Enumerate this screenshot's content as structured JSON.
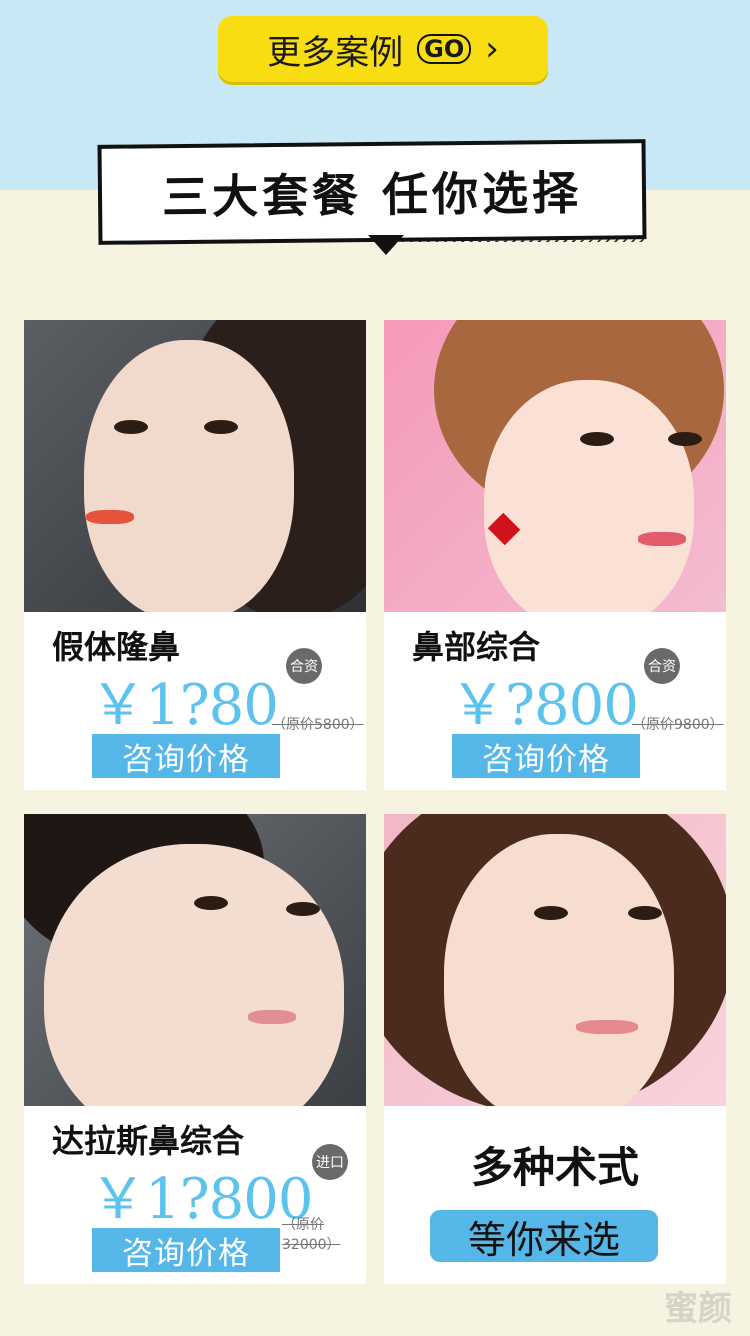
{
  "more_cases": {
    "label": "更多案例",
    "go_icon": "GO",
    "arrow_icon": "chevron-right-icon"
  },
  "banner": {
    "title": "三大套餐  任你选择"
  },
  "cards": [
    {
      "title": "假体隆鼻",
      "tag": "合资",
      "price": "￥1?80",
      "original_price": "（原价5800）",
      "button": "咨询价格"
    },
    {
      "title": "鼻部综合",
      "tag": "合资",
      "price": "￥?800",
      "original_price": "（原价9800）",
      "button": "咨询价格"
    },
    {
      "title": "达拉斯鼻综合",
      "tag": "进口",
      "price": "￥1?800",
      "original_price": "（原价32000）",
      "button": "咨询价格"
    },
    {
      "title": "多种术式",
      "button": "等你来选"
    }
  ],
  "watermark": "蜜颜",
  "colors": {
    "accent_blue": "#55b7e8",
    "price_blue": "#5cc3ee",
    "button_yellow": "#f7dd12",
    "sky": "#c8e8f6",
    "cream": "#f6f3e1"
  }
}
